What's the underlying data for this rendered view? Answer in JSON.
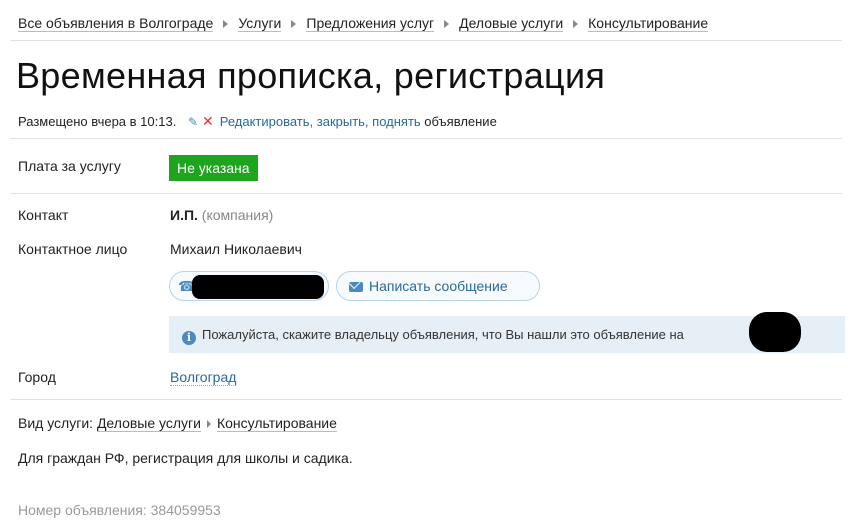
{
  "breadcrumb": [
    "Все объявления в Волгограде",
    "Услуги",
    "Предложения услуг",
    "Деловые услуги",
    "Консультирование"
  ],
  "title": "Временная прописка, регистрация",
  "meta": {
    "posted": "Размещено вчера в 10:13.",
    "edit_link": "Редактировать, закрыть, поднять",
    "suffix": " объявление"
  },
  "price": {
    "label": "Плата за услугу",
    "value": "Не указана"
  },
  "contact": {
    "label": "Контакт",
    "name": "И.П.",
    "kind": "(компания)",
    "person_label": "Контактное лицо",
    "person": "Михаил Николаевич"
  },
  "actions": {
    "message_button": "Написать сообщение"
  },
  "notice": "Пожалуйста, скажите владельцу объявления, что Вы нашли это объявление на",
  "city": {
    "label": "Город",
    "value": "Волгоград"
  },
  "service": {
    "label": "Вид услуги:",
    "category": "Деловые услуги",
    "subcategory": "Консультирование"
  },
  "description": "Для граждан РФ, регистрация для школы и садика.",
  "ad_number": {
    "label": "Номер объявления:",
    "value": "384059953"
  },
  "colors": {
    "accent_link": "#2a6a9a",
    "badge_green": "#1ea51e",
    "notice_bg": "#e6eff6"
  },
  "icons": [
    "pencil-icon",
    "delete-icon",
    "phone-icon",
    "envelope-icon",
    "info-icon"
  ]
}
